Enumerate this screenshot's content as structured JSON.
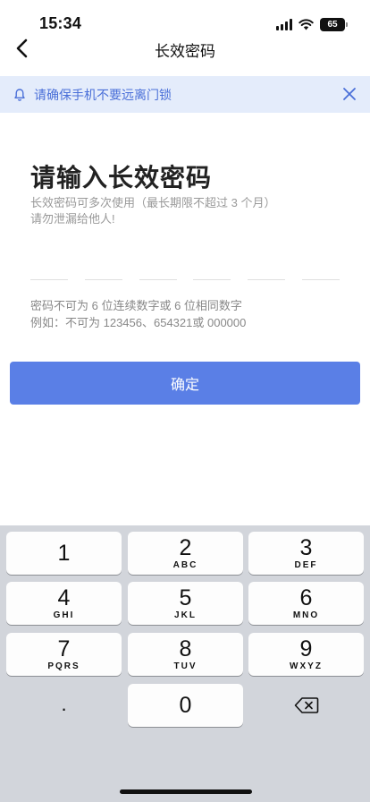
{
  "status_bar": {
    "time": "15:34",
    "battery_level": "65"
  },
  "nav": {
    "title": "长效密码",
    "back_icon": "chevron-left-icon"
  },
  "banner": {
    "icon": "bell-icon",
    "text": "请确保手机不要远离门锁",
    "close_icon": "close-icon"
  },
  "content": {
    "heading": "请输入长效密码",
    "subtext_line1": "长效密码可多次使用（最长期限不超过 3 个月）",
    "subtext_line2": "请勿泄漏给他人!",
    "pin_length": 6,
    "rule_line1": "密码不可为 6 位连续数字或 6 位相同数字",
    "rule_line2": "例如：不可为 123456、654321或 000000"
  },
  "confirm_label": "确定",
  "keyboard": {
    "keys": [
      {
        "digit": "1",
        "letters": ""
      },
      {
        "digit": "2",
        "letters": "ABC"
      },
      {
        "digit": "3",
        "letters": "DEF"
      },
      {
        "digit": "4",
        "letters": "GHI"
      },
      {
        "digit": "5",
        "letters": "JKL"
      },
      {
        "digit": "6",
        "letters": "MNO"
      },
      {
        "digit": "7",
        "letters": "PQRS"
      },
      {
        "digit": "8",
        "letters": "TUV"
      },
      {
        "digit": "9",
        "letters": "WXYZ"
      }
    ],
    "dot_label": ".",
    "zero_label": "0",
    "delete_icon": "delete-backspace-icon"
  },
  "colors": {
    "accent": "#5a7fe6",
    "banner_bg": "#e4ecfb",
    "banner_text": "#4a6fd8",
    "keyboard_bg": "#d2d5db"
  }
}
